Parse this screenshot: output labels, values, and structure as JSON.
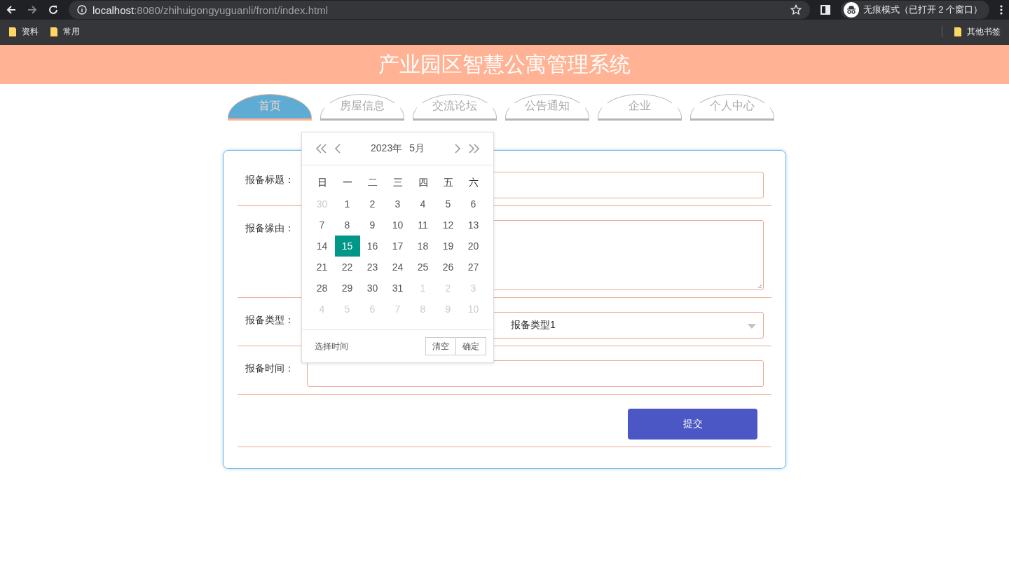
{
  "browser": {
    "url_host": "localhost",
    "url_path": ":8080/zhihuigongyuguanli/front/index.html",
    "incognito": "无痕模式（已打开 2 个窗口）",
    "bookmarks": [
      "资料",
      "常用"
    ],
    "other_bookmarks": "其他书签"
  },
  "header": {
    "title": "产业园区智慧公寓管理系统"
  },
  "tabs": [
    {
      "label": "首页",
      "selected": true
    },
    {
      "label": "房屋信息",
      "selected": false
    },
    {
      "label": "交流论坛",
      "selected": false
    },
    {
      "label": "公告通知",
      "selected": false
    },
    {
      "label": "企业",
      "selected": false
    },
    {
      "label": "个人中心",
      "selected": false
    }
  ],
  "form": {
    "fields": [
      {
        "kind": "input",
        "label": "报备标题："
      },
      {
        "kind": "textarea",
        "label": "报备缘由："
      },
      {
        "kind": "select",
        "label": "报备类型：",
        "value": "报备类型1"
      },
      {
        "kind": "input",
        "label": "报备时间："
      }
    ],
    "submit": "提交"
  },
  "datepicker": {
    "year": "2023年",
    "month": "5月",
    "weekdays": [
      "日",
      "一",
      "二",
      "三",
      "四",
      "五",
      "六"
    ],
    "days": [
      {
        "label": "30",
        "muted": true,
        "selected": false
      },
      {
        "label": "1",
        "muted": false,
        "selected": false
      },
      {
        "label": "2",
        "muted": false,
        "selected": false
      },
      {
        "label": "3",
        "muted": false,
        "selected": false
      },
      {
        "label": "4",
        "muted": false,
        "selected": false
      },
      {
        "label": "5",
        "muted": false,
        "selected": false
      },
      {
        "label": "6",
        "muted": false,
        "selected": false
      },
      {
        "label": "7",
        "muted": false,
        "selected": false
      },
      {
        "label": "8",
        "muted": false,
        "selected": false
      },
      {
        "label": "9",
        "muted": false,
        "selected": false
      },
      {
        "label": "10",
        "muted": false,
        "selected": false
      },
      {
        "label": "11",
        "muted": false,
        "selected": false
      },
      {
        "label": "12",
        "muted": false,
        "selected": false
      },
      {
        "label": "13",
        "muted": false,
        "selected": false
      },
      {
        "label": "14",
        "muted": false,
        "selected": false
      },
      {
        "label": "15",
        "muted": false,
        "selected": true
      },
      {
        "label": "16",
        "muted": false,
        "selected": false
      },
      {
        "label": "17",
        "muted": false,
        "selected": false
      },
      {
        "label": "18",
        "muted": false,
        "selected": false
      },
      {
        "label": "19",
        "muted": false,
        "selected": false
      },
      {
        "label": "20",
        "muted": false,
        "selected": false
      },
      {
        "label": "21",
        "muted": false,
        "selected": false
      },
      {
        "label": "22",
        "muted": false,
        "selected": false
      },
      {
        "label": "23",
        "muted": false,
        "selected": false
      },
      {
        "label": "24",
        "muted": false,
        "selected": false
      },
      {
        "label": "25",
        "muted": false,
        "selected": false
      },
      {
        "label": "26",
        "muted": false,
        "selected": false
      },
      {
        "label": "27",
        "muted": false,
        "selected": false
      },
      {
        "label": "28",
        "muted": false,
        "selected": false
      },
      {
        "label": "29",
        "muted": false,
        "selected": false
      },
      {
        "label": "30",
        "muted": false,
        "selected": false
      },
      {
        "label": "31",
        "muted": false,
        "selected": false
      },
      {
        "label": "1",
        "muted": true,
        "selected": false
      },
      {
        "label": "2",
        "muted": true,
        "selected": false
      },
      {
        "label": "3",
        "muted": true,
        "selected": false
      },
      {
        "label": "4",
        "muted": true,
        "selected": false
      },
      {
        "label": "5",
        "muted": true,
        "selected": false
      },
      {
        "label": "6",
        "muted": true,
        "selected": false
      },
      {
        "label": "7",
        "muted": true,
        "selected": false
      },
      {
        "label": "8",
        "muted": true,
        "selected": false
      },
      {
        "label": "9",
        "muted": true,
        "selected": false
      },
      {
        "label": "10",
        "muted": true,
        "selected": false
      }
    ],
    "select_time": "选择时间",
    "buttons": [
      "清空",
      "确定"
    ]
  }
}
